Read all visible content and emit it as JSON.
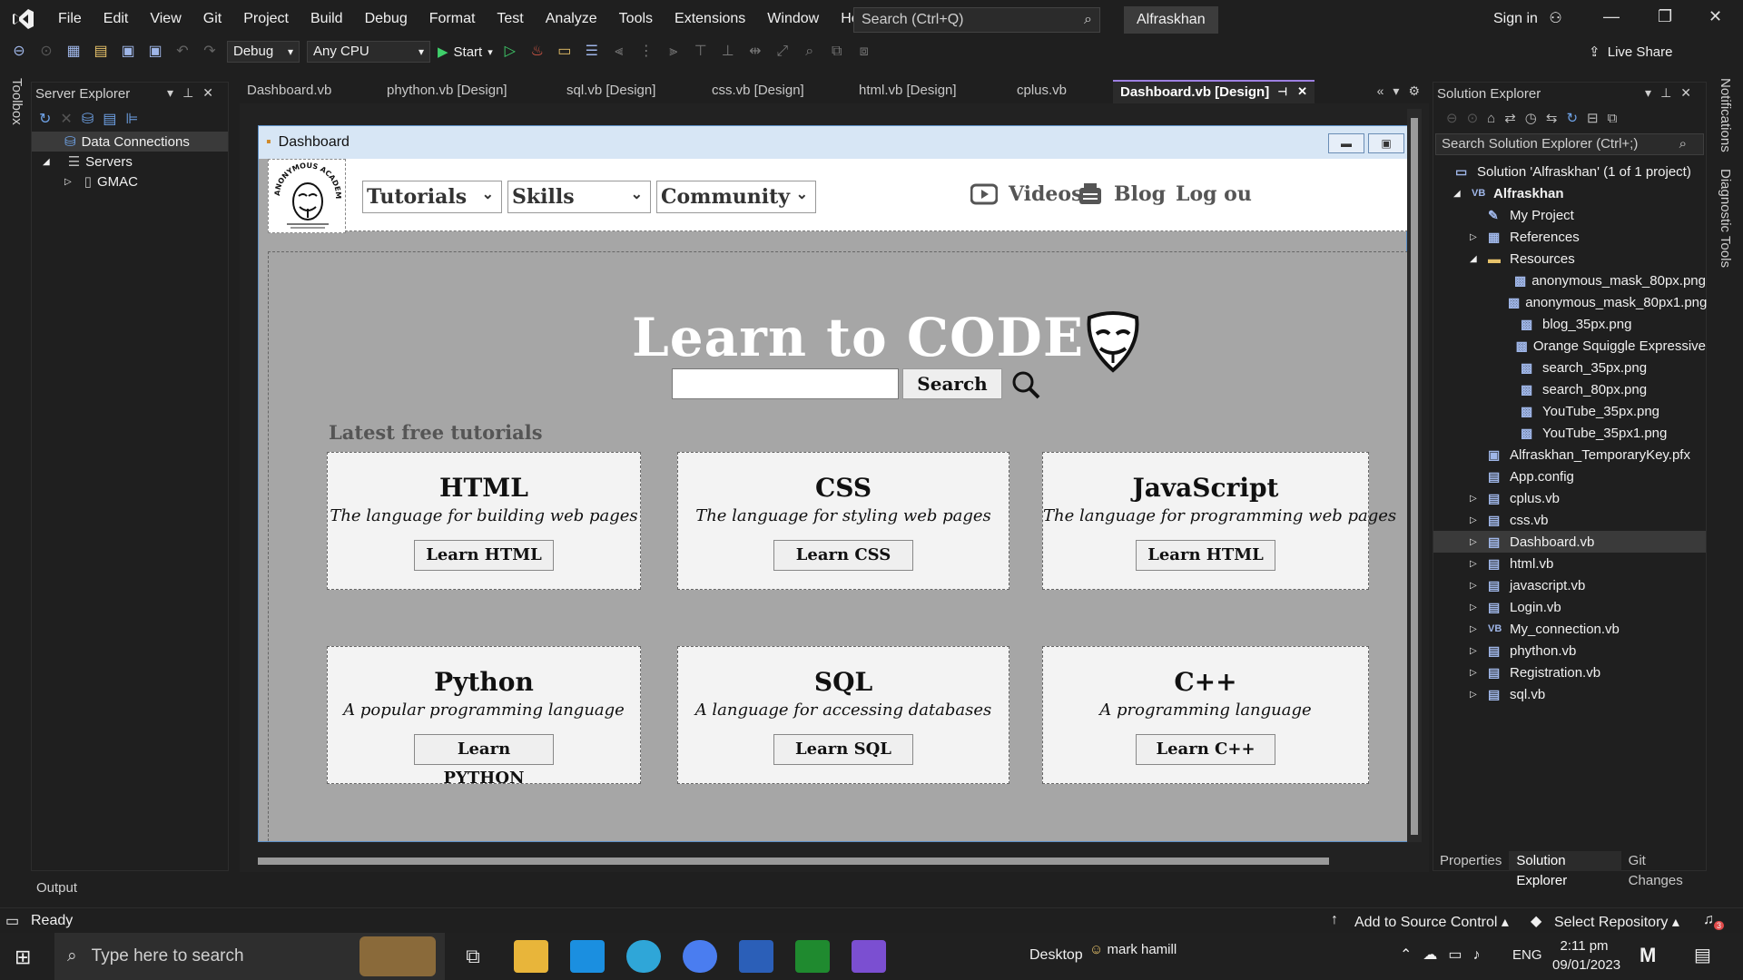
{
  "menubar": {
    "items": [
      "File",
      "Edit",
      "View",
      "Git",
      "Project",
      "Build",
      "Debug",
      "Format",
      "Test",
      "Analyze",
      "Tools",
      "Extensions",
      "Window",
      "Help"
    ],
    "search_placeholder": "Search (Ctrl+Q)",
    "solution_name": "Alfraskhan",
    "sign_in": "Sign in"
  },
  "toolbar": {
    "config": "Debug",
    "platform": "Any CPU",
    "start": "Start",
    "live_share": "Live Share"
  },
  "left": {
    "toolbox_label": "Toolbox",
    "server_explorer_title": "Server Explorer",
    "tree": [
      "Data Connections",
      "Servers",
      "GMAC"
    ]
  },
  "tabs": [
    "Dashboard.vb",
    "phython.vb [Design]",
    "sql.vb [Design]",
    "css.vb [Design]",
    "html.vb [Design]",
    "cplus.vb",
    "Dashboard.vb [Design]"
  ],
  "form": {
    "title": "Dashboard",
    "nav": {
      "combos": [
        "Tutorials",
        "Skills",
        "Community"
      ],
      "videos": "Videos",
      "blog": "Blog",
      "logout": "Log ou"
    },
    "hero_title": "Learn to CODE",
    "search_button": "Search",
    "latest_label": "Latest free tutorials",
    "cards": [
      {
        "title": "HTML",
        "desc": "The language for building web pages",
        "button": "Learn HTML"
      },
      {
        "title": "CSS",
        "desc": "The language for styling web pages",
        "button": "Learn CSS"
      },
      {
        "title": "JavaScript",
        "desc": "The language for programming web pages",
        "button": "Learn HTML"
      },
      {
        "title": "Python",
        "desc": "A popular programming language",
        "button": "Learn PYTHON"
      },
      {
        "title": "SQL",
        "desc": "A language for accessing databases",
        "button": "Learn SQL"
      },
      {
        "title": "C++",
        "desc": "A programming language",
        "button": "Learn C++"
      }
    ]
  },
  "solution_explorer": {
    "title": "Solution Explorer",
    "search_placeholder": "Search Solution Explorer (Ctrl+;)",
    "items": [
      "Solution 'Alfraskhan' (1 of 1 project)",
      "Alfraskhan",
      "My Project",
      "References",
      "Resources",
      "anonymous_mask_80px.png",
      "anonymous_mask_80px1.png",
      "blog_35px.png",
      "Orange Squiggle Expressive",
      "search_35px.png",
      "search_80px.png",
      "YouTube_35px.png",
      "YouTube_35px1.png",
      "Alfraskhan_TemporaryKey.pfx",
      "App.config",
      "cplus.vb",
      "css.vb",
      "Dashboard.vb",
      "html.vb",
      "javascript.vb",
      "Login.vb",
      "My_connection.vb",
      "phython.vb",
      "Registration.vb",
      "sql.vb"
    ],
    "bottom_tabs": [
      "Properties",
      "Solution Explorer",
      "Git Changes"
    ],
    "notifications_label": "Notifications",
    "diagnostic_label": "Diagnostic Tools"
  },
  "output_label": "Output",
  "status": {
    "ready": "Ready",
    "source_control": "Add to Source Control",
    "repository": "Select Repository",
    "notif_count": "3"
  },
  "taskbar": {
    "search_placeholder": "Type here to search",
    "desktop": "Desktop",
    "user": "mark hamill",
    "lang": "ENG",
    "time": "2:11 pm",
    "date": "09/01/2023"
  },
  "colors": {
    "accent": "#9d7fe0",
    "form_bg": "#a6a6a6",
    "ide_bg": "#1f1f1f"
  }
}
